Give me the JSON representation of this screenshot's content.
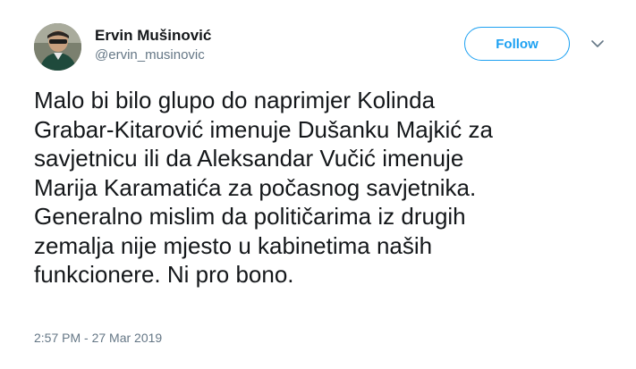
{
  "author": {
    "display_name": "Ervin Mušinović",
    "handle": "@ervin_musinovic",
    "avatar_icon": "profile-photo"
  },
  "actions": {
    "follow_label": "Follow",
    "more_icon": "chevron-down-icon"
  },
  "tweet": {
    "text": "Malo bi bilo glupo do naprimjer Kolinda\nGrabar-Kitarović imenuje Dušanku Majkić za\nsavjetnicu ili da Aleksandar Vučić imenuje\nMarija Karamatića za počasnog savjetnika.\nGeneralno mislim da političarima iz drugih\nzemalja nije mjesto u kabinetima naših\nfunkcionere. Ni pro bono.",
    "timestamp": "2:57 PM - 27 Mar 2019"
  },
  "colors": {
    "accent": "#1da1f2",
    "secondary_text": "#657786",
    "primary_text": "#14171a"
  }
}
